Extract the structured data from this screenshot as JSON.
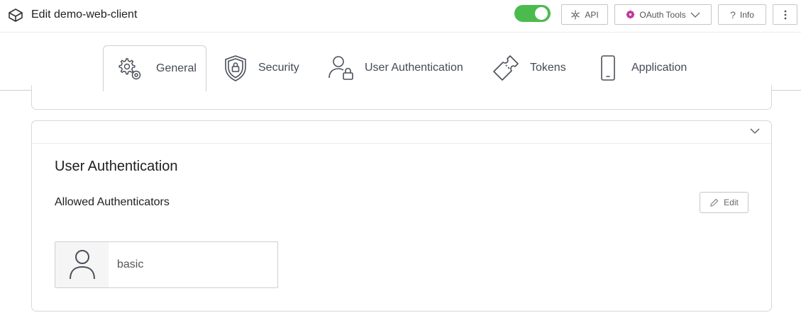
{
  "header": {
    "title": "Edit demo-web-client",
    "enabled": true,
    "buttons": {
      "api": "API",
      "oauth_tools": "OAuth Tools",
      "info": "Info"
    },
    "colors": {
      "toggle_on": "#4cbb4e",
      "oauth_icon": "#c0389a"
    }
  },
  "tabs": [
    {
      "label": "General",
      "icon": "gears-icon",
      "active": true
    },
    {
      "label": "Security",
      "icon": "shield-icon",
      "active": false
    },
    {
      "label": "User Authentication",
      "icon": "user-lock-icon",
      "active": false
    },
    {
      "label": "Tokens",
      "icon": "ticket-icon",
      "active": false
    },
    {
      "label": "Application",
      "icon": "phone-icon",
      "active": false
    }
  ],
  "section": {
    "title": "User Authentication",
    "subtitle": "Allowed Authenticators",
    "edit_label": "Edit",
    "authenticators": [
      {
        "label": "basic",
        "icon": "user-icon"
      }
    ]
  }
}
